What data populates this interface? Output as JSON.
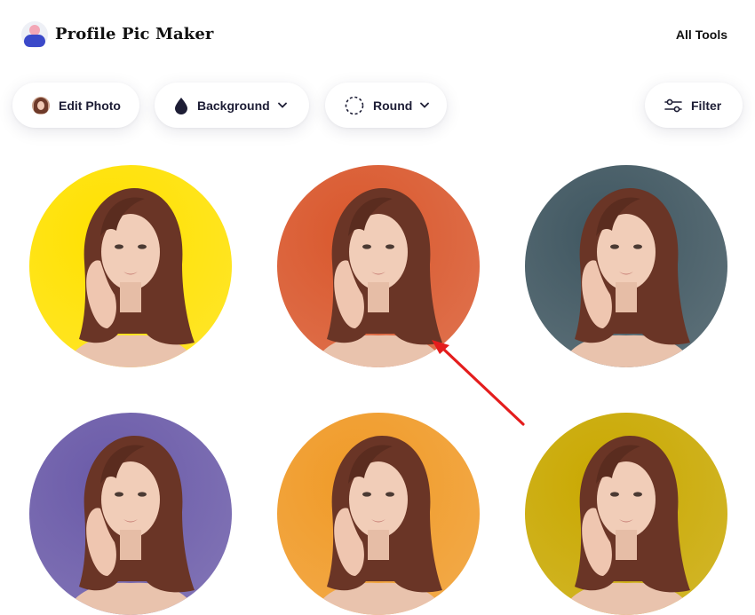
{
  "header": {
    "app_title": "Profile Pic Maker",
    "all_tools_label": "All Tools"
  },
  "toolbar": {
    "edit_photo_label": "Edit Photo",
    "background_label": "Background",
    "shape_label": "Round",
    "filter_label": "Filter"
  },
  "colors": {
    "tile_1": "#ffe100",
    "tile_2": "#d9572c",
    "tile_3": "#3f5660",
    "tile_4": "#6a5aa8",
    "tile_5": "#f09a27",
    "tile_6": "#c9a800",
    "annotation_arrow": "#e41d1d",
    "accent_blue": "#3b49c9"
  },
  "icons": [
    "user-avatar-logo-icon",
    "photo-thumb-icon",
    "droplet-icon",
    "dashed-circle-icon",
    "chevron-down-icon",
    "sliders-filter-icon",
    "red-arrow-annotation"
  ]
}
